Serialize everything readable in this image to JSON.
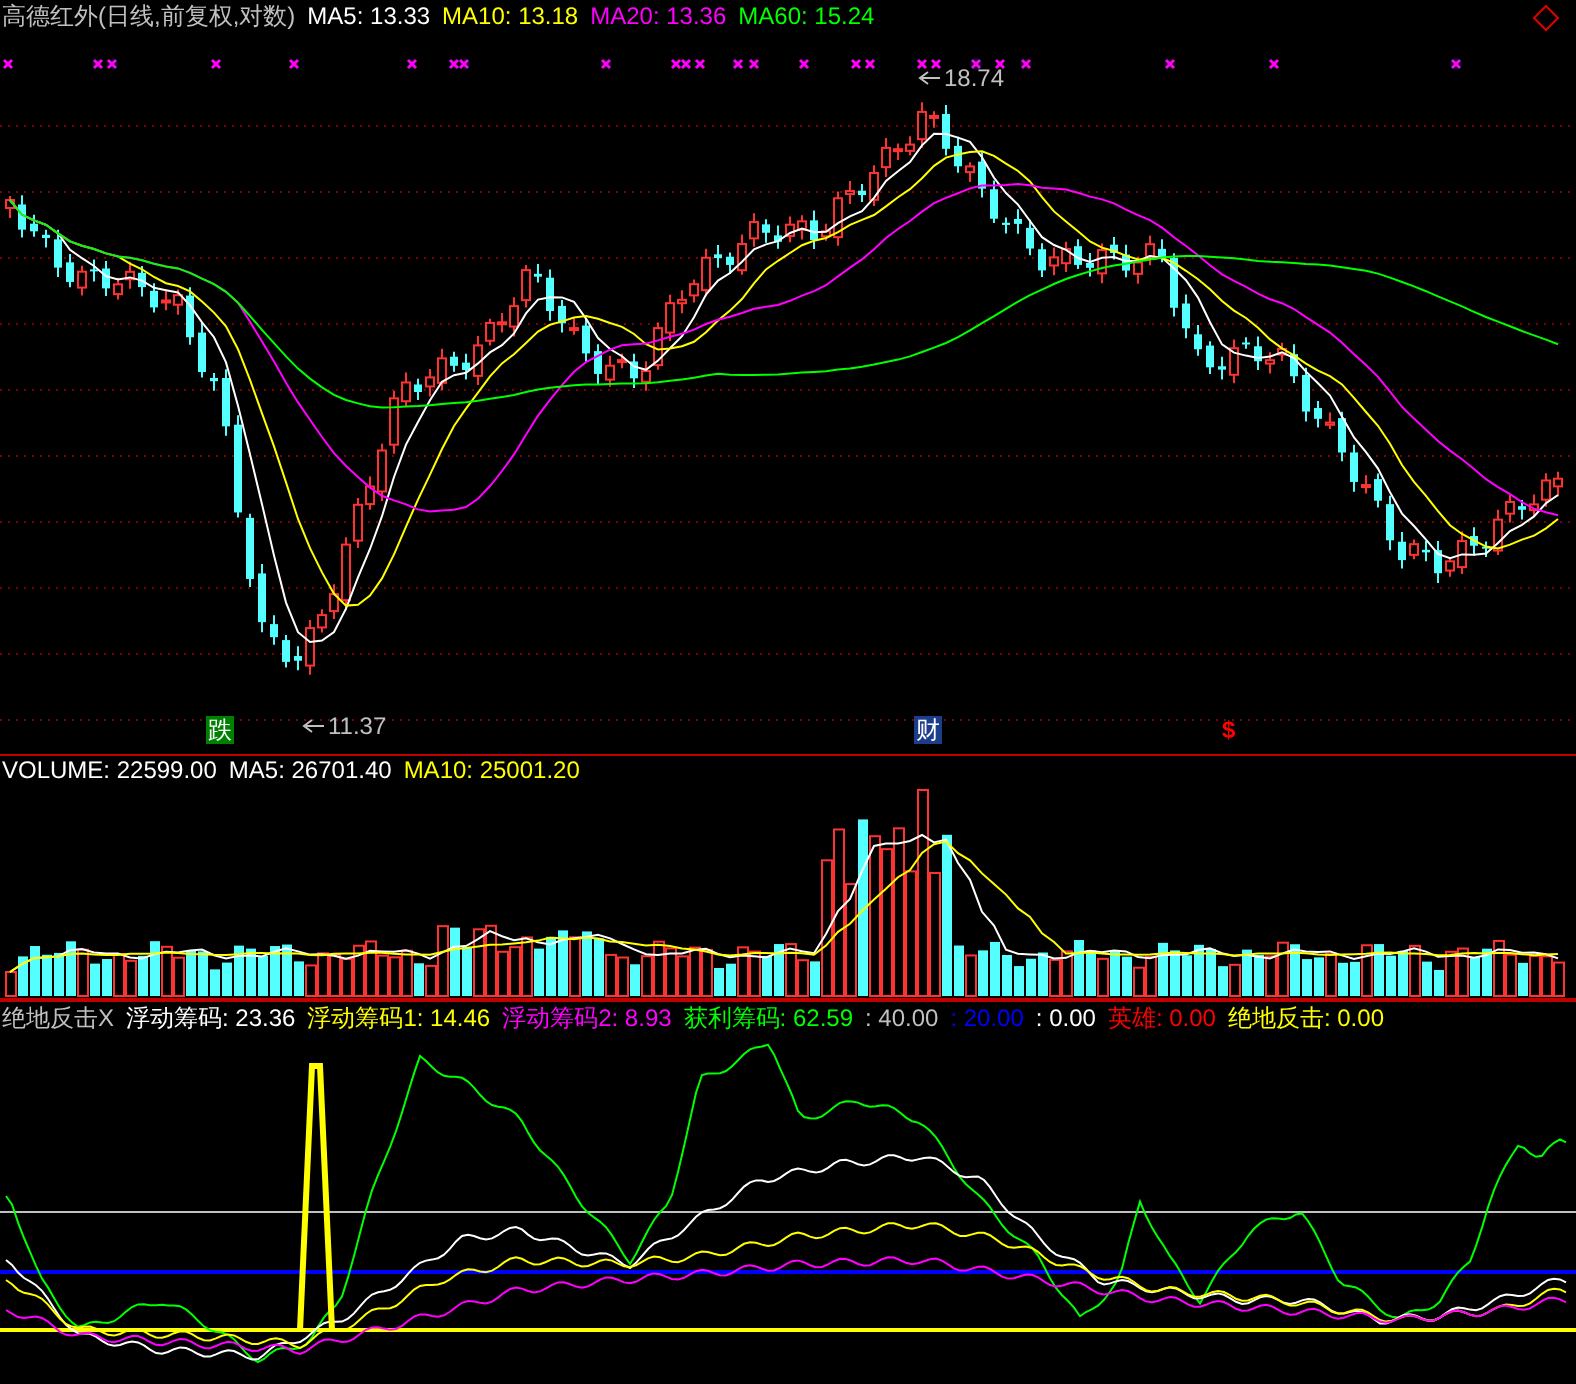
{
  "price_pane": {
    "title": "高德红外(日线,前复权,对数)",
    "legend": [
      {
        "label": "MA5: 13.33",
        "color": "#ffffff"
      },
      {
        "label": "MA10: 13.18",
        "color": "#ffff00"
      },
      {
        "label": "MA20: 13.36",
        "color": "#ff00ff"
      },
      {
        "label": "MA60: 15.24",
        "color": "#00ff00"
      }
    ],
    "high_label": "18.74",
    "low_label": "11.37",
    "signals": [
      {
        "kind": "badge",
        "label": "跌",
        "color": "#008000"
      },
      {
        "kind": "badge",
        "label": "财",
        "color": "#1c3c8c"
      },
      {
        "kind": "glyph",
        "label": "$",
        "color": "#ff0000"
      }
    ]
  },
  "volume_pane": {
    "legend": [
      {
        "label": "VOLUME: 22599.00",
        "color": "#ffffff"
      },
      {
        "label": "MA5: 26701.40",
        "color": "#ffffff"
      },
      {
        "label": "MA10: 25001.20",
        "color": "#ffff00"
      }
    ]
  },
  "indicator_pane": {
    "title": "绝地反击X",
    "legend": [
      {
        "label": "浮动筹码: 23.36",
        "color": "#ffffff"
      },
      {
        "label": "浮动筹码1: 14.46",
        "color": "#ffff00"
      },
      {
        "label": "浮动筹码2: 8.93",
        "color": "#ff00ff"
      },
      {
        "label": "获利筹码: 62.59",
        "color": "#00ff00"
      },
      {
        "label": ": 40.00",
        "color": "#c0c0c0"
      },
      {
        "label": ": 20.00",
        "color": "#0000ff"
      },
      {
        "label": ": 0.00",
        "color": "#ffffff"
      },
      {
        "label": "英雄: 0.00",
        "color": "#ff0000"
      },
      {
        "label": "绝地反击: 0.00",
        "color": "#ffff00"
      }
    ]
  }
}
